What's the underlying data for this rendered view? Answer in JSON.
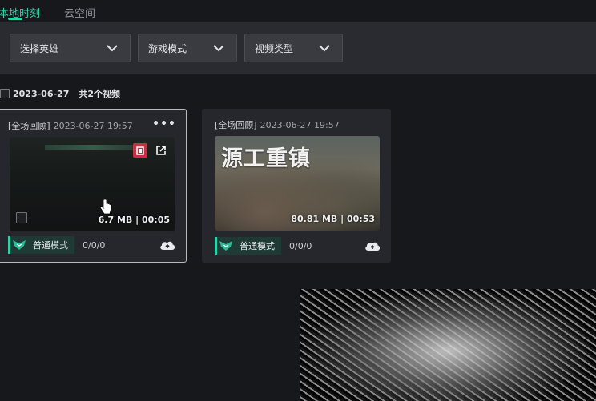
{
  "tabs": [
    {
      "label": "本地时刻",
      "active": true
    },
    {
      "label": "云空间",
      "active": false
    }
  ],
  "filters": {
    "hero": "选择英雄",
    "mode": "游戏模式",
    "type": "视频类型"
  },
  "group": {
    "date": "2023-06-27",
    "count": "共2个视频"
  },
  "videos": [
    {
      "tag": "[全场回顾]",
      "datetime": "2023-06-27 19:57",
      "size": "6.7 MB",
      "duration": "00:05",
      "mode": "普通模式",
      "score": "0/0/0",
      "selected": true
    },
    {
      "tag": "[全场回顾]",
      "datetime": "2023-06-27 19:57",
      "size": "80.81 MB",
      "duration": "00:53",
      "mode": "普通模式",
      "score": "0/0/0",
      "title_overlay": "源工重镇",
      "selected": false
    }
  ],
  "colors": {
    "accent": "#2fd1a8",
    "delete": "#c23344",
    "panel": "#2a2b30"
  },
  "icons": [
    "chevron-down-icon",
    "more-icon",
    "delete-icon",
    "share-icon",
    "emblem-icon",
    "cloud-upload-icon",
    "cursor-hand-icon"
  ]
}
